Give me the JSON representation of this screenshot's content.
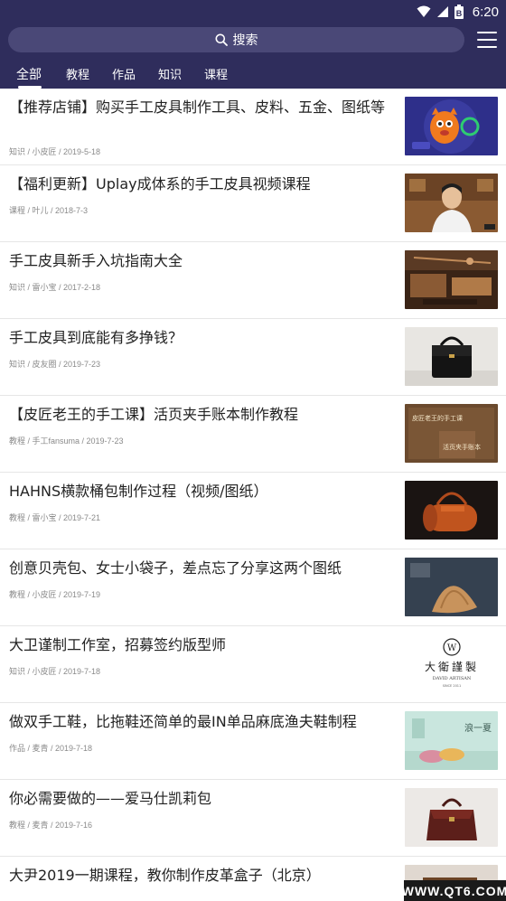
{
  "status_bar": {
    "time": "6:20",
    "battery_glyph": "B"
  },
  "search": {
    "label": "搜索"
  },
  "tabs": [
    {
      "label": "全部",
      "active": true
    },
    {
      "label": "教程",
      "active": false
    },
    {
      "label": "作品",
      "active": false
    },
    {
      "label": "知识",
      "active": false
    },
    {
      "label": "课程",
      "active": false
    }
  ],
  "articles": [
    {
      "title": "【推荐店铺】购买手工皮具制作工具、皮料、五金、图纸等",
      "meta": "知识 / 小皮匠 / 2019-5-18",
      "thumb": "mascot"
    },
    {
      "title": "【福利更新】Uplay成体系的手工皮具视频课程",
      "meta": "课程 / 叶儿 / 2018-7-3",
      "thumb": "instructor"
    },
    {
      "title": "手工皮具新手入坑指南大全",
      "meta": "知识 / 雷小宝 / 2017-2-18",
      "thumb": "workbench"
    },
    {
      "title": "手工皮具到底能有多挣钱？",
      "meta": "知识 / 皮友圈 / 2019-7-23",
      "thumb": "handbag-black"
    },
    {
      "title": "【皮匠老王的手工课】活页夹手账本制作教程",
      "meta": "教程 / 手工fansuma / 2019-7-23",
      "thumb": "notebook"
    },
    {
      "title": "HAHNS横款桶包制作过程（视频/图纸）",
      "meta": "教程 / 雷小宝 / 2019-7-21",
      "thumb": "barrel-bag"
    },
    {
      "title": "创意贝壳包、女士小袋子，差点忘了分享这两个图纸",
      "meta": "教程 / 小皮匠 / 2019-7-19",
      "thumb": "shell-bag"
    },
    {
      "title": "大卫谨制工作室，招募签约版型师",
      "meta": "知识 / 小皮匠 / 2019-7-18",
      "thumb": "logo"
    },
    {
      "title": "做双手工鞋，比拖鞋还简单的最IN单品麻底渔夫鞋制程",
      "meta": "作品 / 麦青 / 2019-7-18",
      "thumb": "shoes"
    },
    {
      "title": "你必需要做的——爱马仕凯莉包",
      "meta": "教程 / 麦青 / 2019-7-16",
      "thumb": "kelly-bag"
    },
    {
      "title": "大尹2019一期课程，教你制作皮革盒子（北京）",
      "meta": "",
      "thumb": "box"
    }
  ],
  "thumb_texts": {
    "notebook_line1": "皮匠老王的手工课",
    "notebook_line2": "活页夹手账本",
    "logo_name": "大衛謹製",
    "logo_en": "DAVID ARTISAN",
    "logo_since": "SINCE 2011",
    "shoes_text": "浪一夏"
  },
  "watermark": "WWW.QT6.COM",
  "colors": {
    "header": "#2f2d5c",
    "search_bg": "#4a4877"
  }
}
